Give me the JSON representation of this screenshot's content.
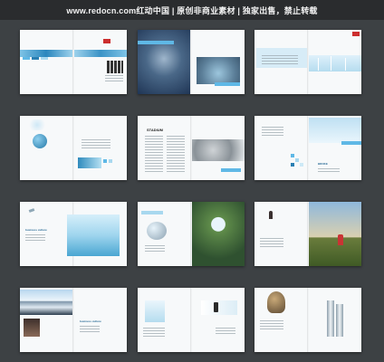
{
  "header": {
    "text": "www.redocn.com红动中国 | 原创非商业素材 | 独家出售，禁止转载"
  },
  "spreads": [
    {
      "texts": []
    },
    {
      "texts": []
    },
    {
      "texts": []
    },
    {
      "texts": []
    },
    {
      "texts": [
        "STADIUM"
      ]
    },
    {
      "texts": [
        "BROKE"
      ]
    },
    {
      "texts": [
        "business culture"
      ]
    },
    {
      "texts": []
    },
    {
      "texts": []
    },
    {
      "texts": [
        "business culture"
      ]
    },
    {
      "texts": []
    },
    {
      "texts": []
    }
  ],
  "colors": {
    "page_background": "#3d4144",
    "header_background": "#2a2c2e",
    "header_text": "#f2f2f2",
    "accent_blue": "#5fb8e6",
    "brochure_paper": "#f7f9fa"
  }
}
